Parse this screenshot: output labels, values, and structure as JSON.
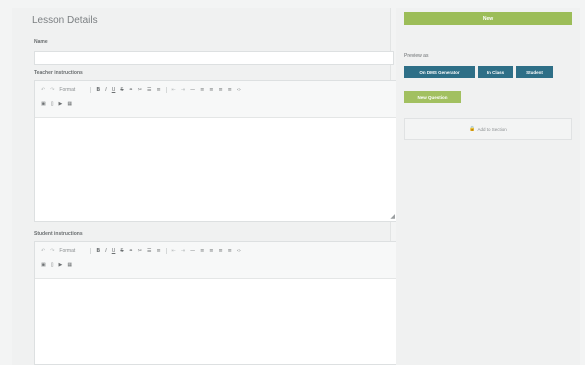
{
  "lesson_details": {
    "title": "Lesson Details",
    "name_label": "Name",
    "name_value": "",
    "teacher_instructions_label": "Teacher instructions",
    "student_instructions_label": "Student instructions",
    "toolbar": {
      "undo": "↶",
      "redo": "↷",
      "format": "Format",
      "bold": "B",
      "italic": "I",
      "underline": "U",
      "strike": "S",
      "link": "⚭",
      "unlink": "✂",
      "bullets": "☰",
      "numbers": "≡",
      "outdent": "⇤",
      "indent": "⇥",
      "align_left": "≡",
      "align_center": "≡",
      "align_right": "≡",
      "align_justify": "≡",
      "hr": "—",
      "code": "‹›",
      "image": "▣",
      "file": "▯",
      "video": "▶",
      "table": "▦"
    }
  },
  "sidebar": {
    "new_label": "New",
    "preview_label": "Preview as",
    "preview_buttons": [
      "On DMS Generator",
      "In Class",
      "Student"
    ],
    "new_question_label": "New Question",
    "add_section_label": "Add to Section"
  }
}
